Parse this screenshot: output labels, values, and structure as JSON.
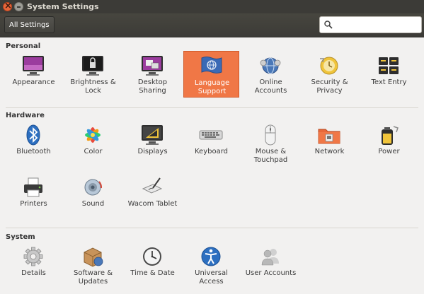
{
  "window": {
    "title": "System Settings"
  },
  "toolbar": {
    "all_settings_label": "All Settings",
    "search": {
      "value": "",
      "placeholder": ""
    }
  },
  "sections": {
    "personal": {
      "title": "Personal",
      "items": [
        {
          "label": "Appearance"
        },
        {
          "label": "Brightness &\nLock"
        },
        {
          "label": "Desktop\nSharing"
        },
        {
          "label": "Language\nSupport",
          "selected": true
        },
        {
          "label": "Online\nAccounts"
        },
        {
          "label": "Security &\nPrivacy"
        },
        {
          "label": "Text Entry"
        }
      ]
    },
    "hardware": {
      "title": "Hardware",
      "items": [
        {
          "label": "Bluetooth"
        },
        {
          "label": "Color"
        },
        {
          "label": "Displays"
        },
        {
          "label": "Keyboard"
        },
        {
          "label": "Mouse &\nTouchpad"
        },
        {
          "label": "Network"
        },
        {
          "label": "Power"
        },
        {
          "label": "Printers"
        },
        {
          "label": "Sound"
        },
        {
          "label": "Wacom Tablet"
        }
      ]
    },
    "system": {
      "title": "System",
      "items": [
        {
          "label": "Details"
        },
        {
          "label": "Software &\nUpdates"
        },
        {
          "label": "Time & Date"
        },
        {
          "label": "Universal\nAccess"
        },
        {
          "label": "User Accounts"
        }
      ]
    }
  },
  "colors": {
    "selected_bg": "#f07746",
    "titlebar": "#3c3b37",
    "window_bg": "#f2f1f0"
  }
}
